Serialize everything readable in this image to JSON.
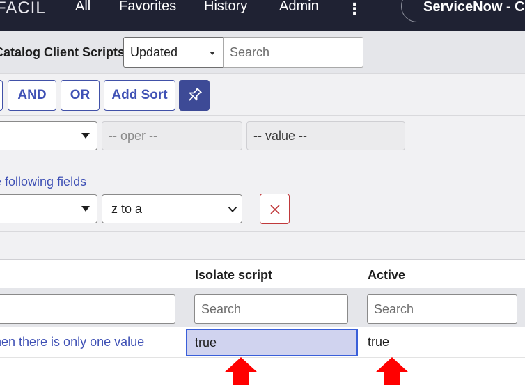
{
  "nav": {
    "brand": "FACIL",
    "items": [
      "All",
      "Favorites",
      "History",
      "Admin"
    ],
    "more_icon": "more-vertical-icon",
    "instance": "ServiceNow - C"
  },
  "list": {
    "title": "Catalog Client Scripts",
    "field_select": "Updated",
    "search_placeholder": "Search"
  },
  "filter": {
    "and_label": "AND",
    "or_label": "OR",
    "add_sort_label": "Add Sort",
    "pin_icon": "pin-icon",
    "oper_placeholder": "-- oper --",
    "value_placeholder": "-- value --",
    "sort_label": "e following fields",
    "sort_order": "z to a",
    "remove_icon": "close-icon"
  },
  "table": {
    "columns": [
      "Isolate script",
      "Active"
    ],
    "search_placeholder": "Search",
    "rows": [
      {
        "name": "hen there is only one value",
        "isolate_script": "true",
        "active": "true"
      }
    ]
  },
  "annotations": {
    "arrow_color": "#ff0000"
  }
}
